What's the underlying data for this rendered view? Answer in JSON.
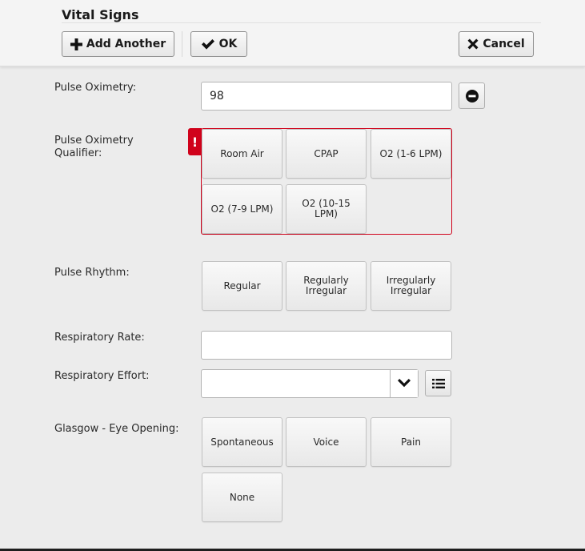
{
  "header": {
    "title": "Vital Signs",
    "add_another_label": "Add Another",
    "ok_label": "OK",
    "cancel_label": "Cancel"
  },
  "fields": {
    "pulse_oximetry": {
      "label": "Pulse Oximetry:",
      "value": "98"
    },
    "pulse_oximetry_qualifier": {
      "label_line1": "Pulse Oximetry",
      "label_line2": "Qualifier:",
      "error_mark": "!",
      "options": [
        "Room Air",
        "CPAP",
        "O2 (1-6 LPM)",
        "O2 (7-9 LPM)",
        "O2 (10-15 LPM)"
      ]
    },
    "pulse_rhythm": {
      "label": "Pulse Rhythm:",
      "options": [
        "Regular",
        "Regularly Irregular",
        "Irregularly Irregular"
      ]
    },
    "respiratory_rate": {
      "label": "Respiratory Rate:",
      "value": ""
    },
    "respiratory_effort": {
      "label": "Respiratory Effort:",
      "value": ""
    },
    "glasgow_eye_opening": {
      "label": "Glasgow - Eye Opening:",
      "options": [
        "Spontaneous",
        "Voice",
        "Pain",
        "None"
      ]
    }
  },
  "colors": {
    "error": "#d0021b",
    "background": "#ececec"
  }
}
